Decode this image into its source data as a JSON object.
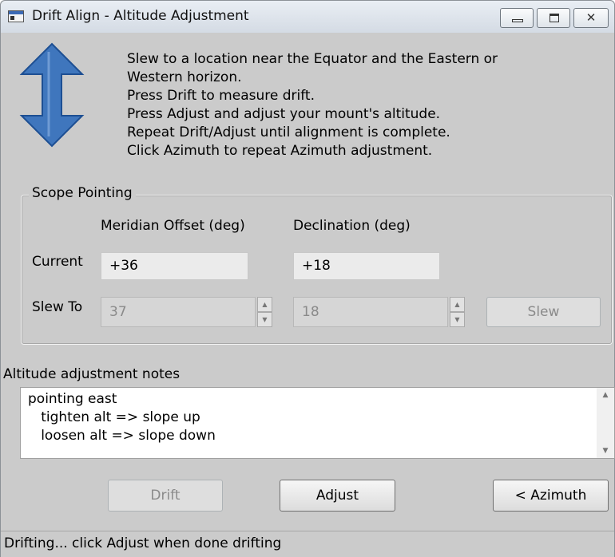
{
  "window": {
    "title": "Drift Align - Altitude Adjustment",
    "caption_buttons": {
      "minimize": "minimize-icon",
      "maximize": "maximize-icon",
      "close": "close-icon"
    }
  },
  "instructions": [
    "Slew to a location near the Equator and the Eastern or",
    "Western horizon.",
    "Press Drift to measure drift.",
    "Press Adjust and adjust your mount's altitude.",
    "Repeat Drift/Adjust until alignment is complete.",
    "Click Azimuth to repeat Azimuth adjustment."
  ],
  "scope_pointing": {
    "legend": "Scope Pointing",
    "meridian_header": "Meridian Offset (deg)",
    "declination_header": "Declination (deg)",
    "current_label": "Current",
    "current_meridian": "+36",
    "current_declination": "+18",
    "slew_to_label": "Slew To",
    "slew_to_meridian": "37",
    "slew_to_declination": "18",
    "slew_button": "Slew"
  },
  "notes": {
    "label": "Altitude adjustment notes",
    "text": "pointing east\n   tighten alt => slope up\n   loosen alt => slope down"
  },
  "actions": {
    "drift": "Drift",
    "adjust": "Adjust",
    "azimuth": "< Azimuth"
  },
  "status": "Drifting... click Adjust when done drifting",
  "colors": {
    "arrow_fill": "#3f76bd",
    "window_bg": "#cbcbcb"
  }
}
